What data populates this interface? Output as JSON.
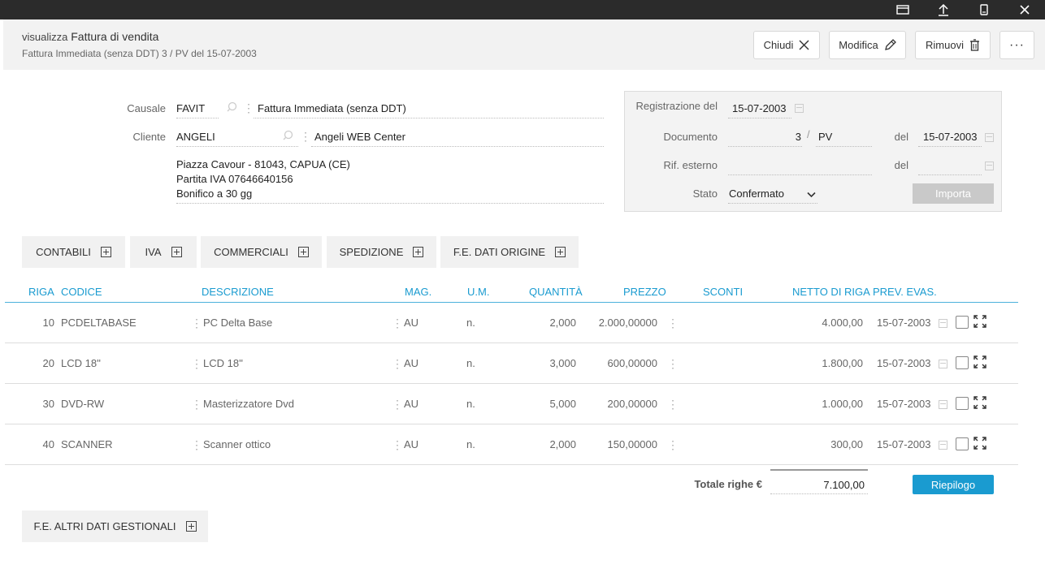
{
  "header": {
    "prefix": "visualizza",
    "title": "Fattura di vendita",
    "subtitle": "Fattura Immediata (senza DDT) 3 / PV del 15-07-2003",
    "buttons": {
      "close": "Chiudi",
      "edit": "Modifica",
      "remove": "Rimuovi"
    }
  },
  "form": {
    "causale_label": "Causale",
    "causale_code": "FAVIT",
    "causale_desc": "Fattura Immediata (senza DDT)",
    "cliente_label": "Cliente",
    "cliente_code": "ANGELI",
    "cliente_desc": "Angeli WEB Center",
    "address": [
      "Piazza Cavour - 81043, CAPUA (CE)",
      "Partita IVA 07646640156",
      "Bonifico a 30 gg"
    ]
  },
  "reg": {
    "registrazione_label": "Registrazione del",
    "registrazione_date": "15-07-2003",
    "documento_label": "Documento",
    "documento_num": "3",
    "slash": "/",
    "documento_serie": "PV",
    "del_label": "del",
    "documento_date": "15-07-2003",
    "rif_label": "Rif. esterno",
    "del2_label": "del",
    "stato_label": "Stato",
    "stato_value": "Confermato",
    "import_label": "Importa"
  },
  "sections": [
    "CONTABILI",
    "IVA",
    "COMMERCIALI",
    "SPEDIZIONE",
    "F.E. DATI ORIGINE"
  ],
  "table": {
    "headers": [
      "RIGA",
      "CODICE",
      "DESCRIZIONE",
      "MAG.",
      "U.M.",
      "QUANTITÀ",
      "PREZZO",
      "SCONTI",
      "NETTO DI RIGA",
      "PREV. EVAS."
    ],
    "rows": [
      {
        "riga": "10",
        "codice": "PCDELTABASE",
        "descrizione": "PC Delta Base",
        "mag": "AU",
        "um": "n.",
        "quantita": "2,000",
        "prezzo": "2.000,00000",
        "netto": "4.000,00",
        "prev": "15-07-2003"
      },
      {
        "riga": "20",
        "codice": "LCD 18''",
        "descrizione": "LCD 18''",
        "mag": "AU",
        "um": "n.",
        "quantita": "3,000",
        "prezzo": "600,00000",
        "netto": "1.800,00",
        "prev": "15-07-2003"
      },
      {
        "riga": "30",
        "codice": "DVD-RW",
        "descrizione": "Masterizzatore Dvd",
        "mag": "AU",
        "um": "n.",
        "quantita": "5,000",
        "prezzo": "200,00000",
        "netto": "1.000,00",
        "prev": "15-07-2003"
      },
      {
        "riga": "40",
        "codice": "SCANNER",
        "descrizione": "Scanner ottico",
        "mag": "AU",
        "um": "n.",
        "quantita": "2,000",
        "prezzo": "150,00000",
        "netto": "300,00",
        "prev": "15-07-2003"
      }
    ]
  },
  "totals": {
    "label": "Totale righe €",
    "value": "7.100,00",
    "riepilogo": "Riepilogo"
  },
  "footer_section": "F.E. ALTRI DATI GESTIONALI",
  "colors": {
    "accent": "#1a9bd0",
    "titlebar": "#2b2b2b",
    "header_bg": "#f2f2f2"
  }
}
